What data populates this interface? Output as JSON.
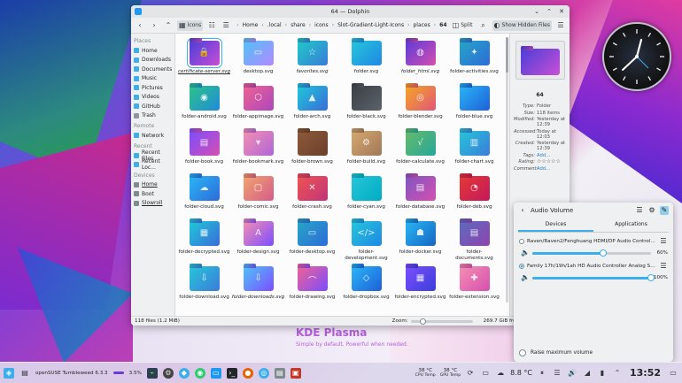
{
  "window": {
    "title": "64 — Dolphin",
    "toolbar": {
      "view_label": "Icons",
      "split_label": "Split",
      "hidden_label": "Show Hidden Files",
      "crumbs": [
        "Home",
        ".local",
        "share",
        "icons",
        "Slot-Gradient-Light-Icons",
        "places",
        "64"
      ]
    },
    "sidebar": {
      "places_head": "Places",
      "places": [
        "Home",
        "Downloads",
        "Documents",
        "Music",
        "Pictures",
        "Videos",
        "GitHub",
        "Trash"
      ],
      "remote_head": "Remote",
      "remote": [
        "Network"
      ],
      "recent_head": "Recent",
      "recent": [
        "Recent Files",
        "Recent Loc..."
      ],
      "devices_head": "Devices",
      "devices": [
        "Home",
        "Boot",
        "Slowroll"
      ]
    },
    "files": [
      {
        "name": "certificate-server.svg",
        "italic": true,
        "c1": "#4a3ed8",
        "c2": "#c94fd6",
        "glyph": "🔒"
      },
      {
        "name": "desktop.svg",
        "italic": false,
        "c1": "#4fc3f7",
        "c2": "#b388ff",
        "glyph": "▭"
      },
      {
        "name": "favorites.svg",
        "italic": true,
        "c1": "#1ec9c9",
        "c2": "#3b7bd8",
        "glyph": "☆"
      },
      {
        "name": "folder.svg",
        "italic": false,
        "c1": "#26c6da",
        "c2": "#1e88e5",
        "glyph": ""
      },
      {
        "name": "folder_html.svg",
        "italic": true,
        "c1": "#5c3bd8",
        "c2": "#d64fb0",
        "glyph": "◍"
      },
      {
        "name": "folder-activities.svg",
        "italic": false,
        "c1": "#26a6c6",
        "c2": "#2d6bd8",
        "glyph": "✦"
      },
      {
        "name": "folder-android.svg",
        "italic": false,
        "c1": "#2ec48a",
        "c2": "#1f8ad8",
        "glyph": "◉"
      },
      {
        "name": "folder-appimage.svg",
        "italic": false,
        "c1": "#f06292",
        "c2": "#ab47bc",
        "glyph": "⬡"
      },
      {
        "name": "folder-arch.svg",
        "italic": false,
        "c1": "#1ec9d9",
        "c2": "#3b6bd8",
        "glyph": "▲"
      },
      {
        "name": "folder-black.svg",
        "italic": false,
        "c1": "#3b3f45",
        "c2": "#5c636b",
        "glyph": ""
      },
      {
        "name": "folder-blender.svg",
        "italic": false,
        "c1": "#f5a623",
        "c2": "#e0567a",
        "glyph": "◎"
      },
      {
        "name": "folder-blue.svg",
        "italic": false,
        "c1": "#29b6f6",
        "c2": "#1e5fd8",
        "glyph": ""
      },
      {
        "name": "folder-book.svg",
        "italic": false,
        "c1": "#7c4dff",
        "c2": "#d64fb0",
        "glyph": "▤"
      },
      {
        "name": "folder-bookmark.svg",
        "italic": false,
        "c1": "#f48fb1",
        "c2": "#b065d6",
        "glyph": "▾"
      },
      {
        "name": "folder-brown.svg",
        "italic": false,
        "c1": "#8d5a3b",
        "c2": "#6b3f2a",
        "glyph": ""
      },
      {
        "name": "folder-build.svg",
        "italic": false,
        "c1": "#d7a86e",
        "c2": "#a0785a",
        "glyph": "⚙"
      },
      {
        "name": "folder-calculate.svg",
        "italic": false,
        "c1": "#66bb6a",
        "c2": "#26a69a",
        "glyph": "√"
      },
      {
        "name": "folder-chart.svg",
        "italic": false,
        "c1": "#26c6da",
        "c2": "#3b7bd8",
        "glyph": "▥"
      },
      {
        "name": "folder-cloud.svg",
        "italic": false,
        "c1": "#29b6f6",
        "c2": "#2d6bd8",
        "glyph": "☁"
      },
      {
        "name": "folder-comic.svg",
        "italic": false,
        "c1": "#f0a46e",
        "c2": "#d65b8a",
        "glyph": "▢"
      },
      {
        "name": "folder-crash.svg",
        "italic": false,
        "c1": "#ef5350",
        "c2": "#c0357a",
        "glyph": "✕"
      },
      {
        "name": "folder-cyan.svg",
        "italic": false,
        "c1": "#26c6da",
        "c2": "#00acc1",
        "glyph": ""
      },
      {
        "name": "folder-database.svg",
        "italic": false,
        "c1": "#7e57c2",
        "c2": "#d64fb0",
        "glyph": "▤"
      },
      {
        "name": "folder-deb.svg",
        "italic": false,
        "c1": "#e53935",
        "c2": "#c2185b",
        "glyph": "◔"
      },
      {
        "name": "folder-decrypted.svg",
        "italic": false,
        "c1": "#1ec9d9",
        "c2": "#3b6bd8",
        "glyph": "▦"
      },
      {
        "name": "folder-design.svg",
        "italic": false,
        "c1": "#f48fb1",
        "c2": "#7c4dff",
        "glyph": "A"
      },
      {
        "name": "folder-desktop.svg",
        "italic": false,
        "c1": "#26a6c6",
        "c2": "#2d6bd8",
        "glyph": "▭"
      },
      {
        "name": "folder-development.svg",
        "italic": false,
        "c1": "#26c6da",
        "c2": "#1e88e5",
        "glyph": "</>"
      },
      {
        "name": "folder-docker.svg",
        "italic": false,
        "c1": "#29b6f6",
        "c2": "#1565c0",
        "glyph": "☗"
      },
      {
        "name": "folder-documents.svg",
        "italic": false,
        "c1": "#5c6bc0",
        "c2": "#8e44ad",
        "glyph": "▤"
      },
      {
        "name": "folder-download.svg",
        "italic": false,
        "c1": "#26c6da",
        "c2": "#3b7bd8",
        "glyph": "⇩"
      },
      {
        "name": "folder-downloads.svg",
        "italic": true,
        "c1": "#4fc3f7",
        "c2": "#7c4dff",
        "glyph": "⇩"
      },
      {
        "name": "folder-drawing.svg",
        "italic": false,
        "c1": "#f06292",
        "c2": "#7c4dff",
        "glyph": "⌒"
      },
      {
        "name": "folder-dropbox.svg",
        "italic": false,
        "c1": "#29b6f6",
        "c2": "#1e5fd8",
        "glyph": "◇"
      },
      {
        "name": "folder-encrypted.svg",
        "italic": false,
        "c1": "#7c4dff",
        "c2": "#3b3fd8",
        "glyph": "▦"
      },
      {
        "name": "folder-extension.svg",
        "italic": false,
        "c1": "#f48fb1",
        "c2": "#d64fb0",
        "glyph": "✚"
      }
    ],
    "info": {
      "name": "64",
      "rows": [
        {
          "k": "Type:",
          "v": "Folder"
        },
        {
          "k": "Size:",
          "v": "118 items"
        },
        {
          "k": "Modified:",
          "v": "Yesterday at 12:39"
        },
        {
          "k": "Accessed:",
          "v": "Today at 12:03"
        },
        {
          "k": "Created:",
          "v": "Yesterday at 12:39"
        },
        {
          "k": "Tags:",
          "v": "Add...",
          "link": true
        },
        {
          "k": "Rating:",
          "v": "☆☆☆☆☆"
        },
        {
          "k": "Comment:",
          "v": "Add...",
          "link": true
        }
      ]
    },
    "status": {
      "count": "118 files (1.2 MiB)",
      "zoom_label": "Zoom:",
      "free": "269.7 GiB free"
    }
  },
  "audio": {
    "title": "Audio Volume",
    "tabs": [
      "Devices",
      "Applications"
    ],
    "devices": [
      {
        "name": "Raven/Raven2/Fenghuang HDMI/DP Audio Controller Dig...",
        "pct": "60%",
        "level": 0.6,
        "selected": false
      },
      {
        "name": "Family 17h/19h/1ah HD Audio Controller Analog Stereo",
        "pct": "100%",
        "level": 1.0,
        "selected": true
      }
    ],
    "footer": "Raise maximum volume"
  },
  "wallpaper": {
    "brand": "KDE Plasma",
    "tagline": "Simple by default. Powerful when needed."
  },
  "taskbar": {
    "os_label": "openSUSE Tumbleweed 6.3.3",
    "cpu_pct": "3.5%",
    "cpu_temp": "38 °C",
    "cpu_temp_label": "CPU Temp",
    "gpu_temp": "38 °C",
    "gpu_temp_label": "GPU Temp",
    "weather": "8.8 °C",
    "time": "13:52"
  }
}
